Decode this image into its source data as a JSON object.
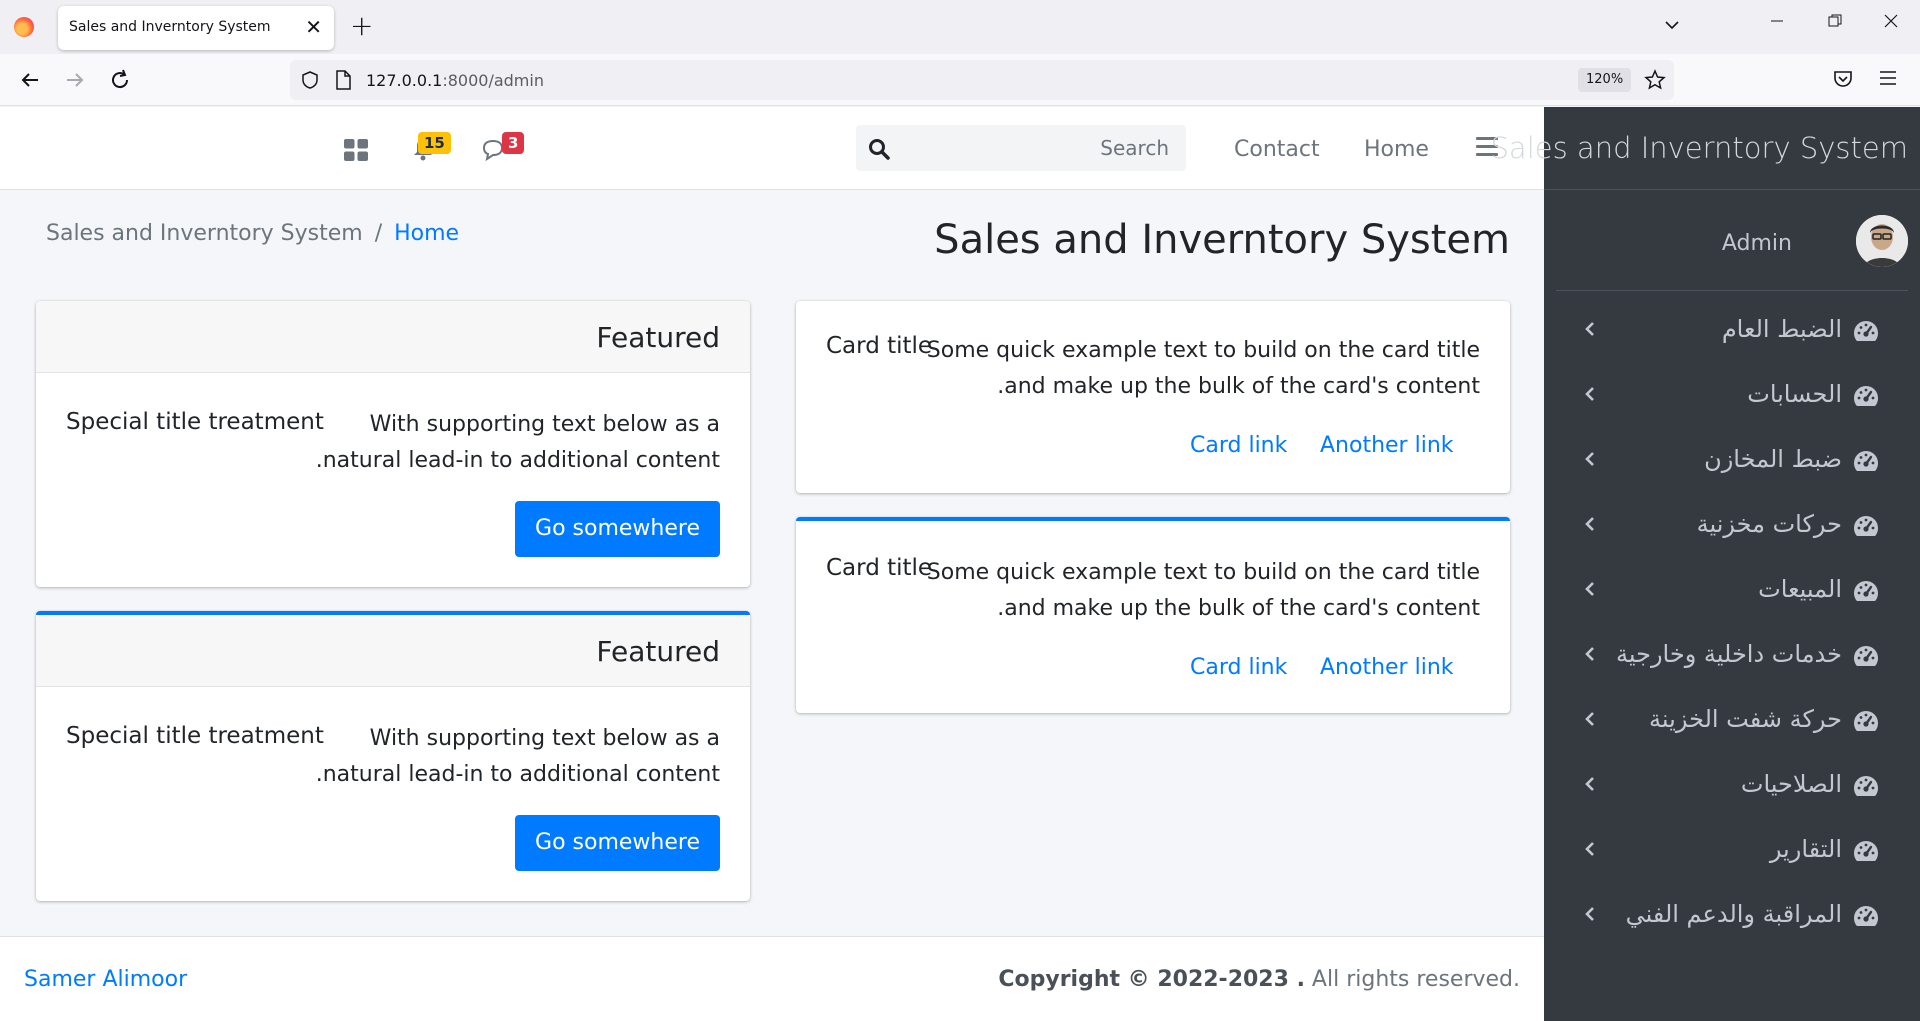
{
  "browser": {
    "tab_title": "Sales and Inverntory System",
    "tab_close": "✕",
    "new_tab": "+",
    "url_host": "127.0.0.1",
    "url_rest": ":8000/admin",
    "zoom": "120%"
  },
  "topbar": {
    "notifications_count": "15",
    "messages_count": "3",
    "search_placeholder": "Search",
    "nav_contact": "Contact",
    "nav_home": "Home"
  },
  "header": {
    "breadcrumb_root": "Sales and Inverntory System",
    "breadcrumb_sep": "/",
    "breadcrumb_active": "Home",
    "page_title": "Sales and Inverntory System"
  },
  "featured_cards": [
    {
      "header": "Featured",
      "title": "Special title treatment",
      "text_line1": "With supporting text below as a",
      "text_line2": ".natural lead-in to additional content",
      "button": "Go somewhere"
    },
    {
      "header": "Featured",
      "title": "Special title treatment",
      "text_line1": "With supporting text below as a",
      "text_line2": ".natural lead-in to additional content",
      "button": "Go somewhere"
    }
  ],
  "link_cards": [
    {
      "title": "Card title",
      "text_line1": "Some quick example text to build on the card title",
      "text_line2": ".and make up the bulk of the card's content",
      "link1": "Card link",
      "link2": "Another link"
    },
    {
      "title": "Card title",
      "text_line1": "Some quick example text to build on the card title",
      "text_line2": ".and make up the bulk of the card's content",
      "link1": "Card link",
      "link2": "Another link"
    }
  ],
  "footer": {
    "author": "Samer Alimoor",
    "copyright": "Copyright © 2022-2023 .",
    "rights": " All rights reserved."
  },
  "sidebar": {
    "brand": "Sales and Inverntory System",
    "user_name": "Admin",
    "items": [
      {
        "label": "الضبط العام",
        "icon": "dashboard-gauge-icon"
      },
      {
        "label": "الحسابات",
        "icon": "dashboard-gauge-icon"
      },
      {
        "label": "ضبط المخازن",
        "icon": "dashboard-gauge-icon"
      },
      {
        "label": "حركات مخزنية",
        "icon": "dashboard-gauge-icon"
      },
      {
        "label": "المبيعات",
        "icon": "dashboard-gauge-icon"
      },
      {
        "label": "خدمات داخلية وخارجية",
        "icon": "dashboard-gauge-icon"
      },
      {
        "label": "حركة شفت الخزينة",
        "icon": "dashboard-gauge-icon"
      },
      {
        "label": "الصلاحيات",
        "icon": "dashboard-gauge-icon"
      },
      {
        "label": "التقارير",
        "icon": "dashboard-gauge-icon"
      },
      {
        "label": "المراقبة والدعم الفني",
        "icon": "dashboard-gauge-icon"
      }
    ]
  },
  "colors": {
    "primary": "#007bff",
    "sidebar_bg": "#343a40",
    "warning": "#ffc107",
    "danger": "#dc3545"
  }
}
